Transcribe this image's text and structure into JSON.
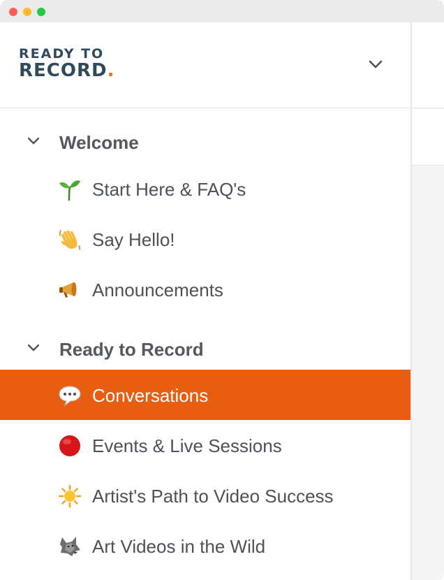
{
  "window": {
    "traffic_lights": {
      "close": "#fe5f57",
      "minimize": "#febc2e",
      "zoom": "#28c840"
    }
  },
  "brand": {
    "line1": "READY TO",
    "line2": "RECORD",
    "dot": ".",
    "colors": {
      "text": "#2f4a5a",
      "accent": "#e96d2b"
    }
  },
  "header": {
    "dropdown_icon": "chevron-down-icon"
  },
  "sections": [
    {
      "label": "Welcome",
      "expanded": true,
      "items": [
        {
          "icon": "seedling-icon",
          "label": "Start Here & FAQ's",
          "active": false
        },
        {
          "icon": "waving-hand-icon",
          "label": "Say Hello!",
          "active": false
        },
        {
          "icon": "megaphone-icon",
          "label": "Announcements",
          "active": false
        }
      ]
    },
    {
      "label": "Ready to Record",
      "expanded": true,
      "items": [
        {
          "icon": "speech-bubble-icon",
          "label": "Conversations",
          "active": true
        },
        {
          "icon": "red-circle-icon",
          "label": "Events & Live Sessions",
          "active": false
        },
        {
          "icon": "sun-icon",
          "label": "Artist's Path to Video Success",
          "active": false
        },
        {
          "icon": "wolf-icon",
          "label": "Art Videos in the Wild",
          "active": false
        }
      ]
    }
  ],
  "colors": {
    "active_item": "#e85d10",
    "text": "#4d5159",
    "section_text": "#545860"
  }
}
